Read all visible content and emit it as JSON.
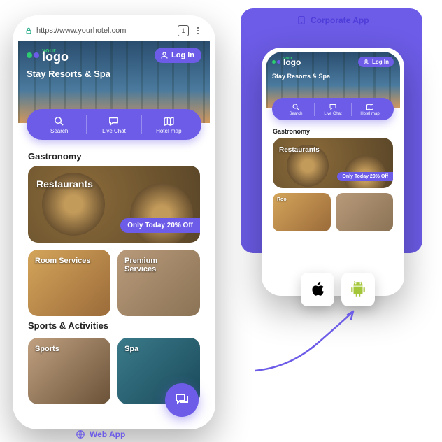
{
  "corporate_label": "Corporate App",
  "web_label": "Web App",
  "url": "https://www.yourhotel.com",
  "tab_count": "1",
  "logo": {
    "your": "your",
    "text": "logo"
  },
  "login": "Log In",
  "hero_title": "Stay Resorts & Spa",
  "actions": [
    {
      "label": "Search"
    },
    {
      "label": "Live Chat"
    },
    {
      "label": "Hotel map"
    }
  ],
  "sections": {
    "gastronomy": {
      "title": "Gastronomy",
      "hero_card": "Restaurants",
      "promo": "Only Today 20% Off",
      "cards": [
        "Room Services",
        "Premium Services"
      ]
    },
    "sports": {
      "title": "Sports & Activities",
      "cards": [
        "Sports",
        "Spa"
      ]
    }
  },
  "phone2": {
    "hero_card2": "Roo"
  },
  "colors": {
    "primary": "#6C5CE7"
  }
}
